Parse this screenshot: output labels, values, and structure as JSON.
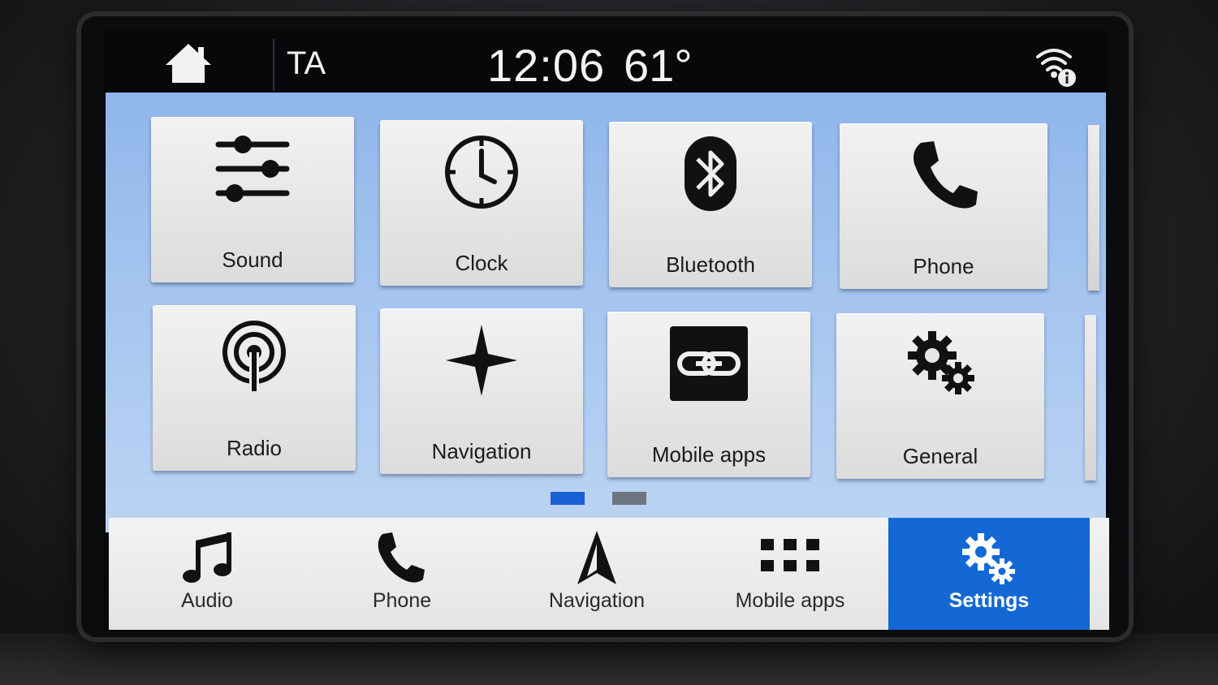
{
  "status_bar": {
    "ta_label": "TA",
    "time": "12:06",
    "temperature": "61°"
  },
  "settings_grid": {
    "tiles": [
      {
        "label": "Sound",
        "icon": "sliders-icon"
      },
      {
        "label": "Clock",
        "icon": "clock-icon"
      },
      {
        "label": "Bluetooth",
        "icon": "bluetooth-icon"
      },
      {
        "label": "Phone",
        "icon": "phone-icon"
      },
      {
        "label": "Radio",
        "icon": "radio-antenna-icon"
      },
      {
        "label": "Navigation",
        "icon": "compass-star-icon"
      },
      {
        "label": "Mobile apps",
        "icon": "link-icon"
      },
      {
        "label": "General",
        "icon": "gears-icon"
      }
    ],
    "page_count": 2,
    "current_page": 1
  },
  "bottom_nav": {
    "items": [
      {
        "label": "Audio",
        "icon": "music-note-icon"
      },
      {
        "label": "Phone",
        "icon": "phone-icon"
      },
      {
        "label": "Navigation",
        "icon": "navigation-arrow-icon"
      },
      {
        "label": "Mobile apps",
        "icon": "app-grid-icon"
      },
      {
        "label": "Settings",
        "icon": "gears-icon"
      }
    ],
    "active": "Settings"
  },
  "colors": {
    "accent": "#1368d6",
    "page_indicator_active": "#1b5fd6",
    "page_indicator_inactive": "#6f7580"
  }
}
